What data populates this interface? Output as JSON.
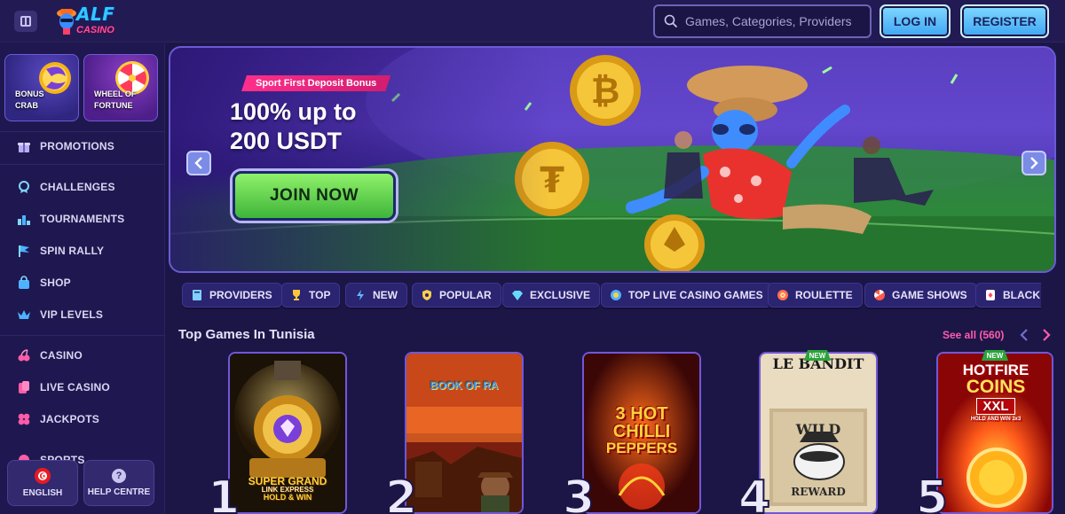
{
  "header": {
    "logo_main": "ALF",
    "logo_sub": "CASINO",
    "search_placeholder": "Games, Categories, Providers",
    "login_label": "LOG IN",
    "register_label": "REGISTER"
  },
  "sidebar": {
    "promo_tiles": [
      {
        "label_1": "BONUS",
        "label_2": "CRAB"
      },
      {
        "label_1": "WHEEL OF",
        "label_2": "FORTUNE"
      }
    ],
    "items": [
      {
        "label": "PROMOTIONS",
        "icon": "gift-icon"
      },
      {
        "label": "CHALLENGES",
        "icon": "medal-icon"
      },
      {
        "label": "TOURNAMENTS",
        "icon": "podium-icon"
      },
      {
        "label": "SPIN RALLY",
        "icon": "flag-icon"
      },
      {
        "label": "SHOP",
        "icon": "bag-icon"
      },
      {
        "label": "VIP LEVELS",
        "icon": "crown-icon"
      },
      {
        "label": "CASINO",
        "icon": "cherry-icon"
      },
      {
        "label": "LIVE CASINO",
        "icon": "cards-icon"
      },
      {
        "label": "JACKPOTS",
        "icon": "clover-icon"
      },
      {
        "label": "SPORTS",
        "icon": "ball-icon"
      }
    ],
    "language_label": "ENGLISH",
    "help_label": "HELP CENTRE",
    "help_glyph": "?"
  },
  "hero": {
    "tag": "Sport First Deposit Bonus",
    "title_line1": "100% up to",
    "title_line2": "200 USDT",
    "cta_label": "JOIN NOW",
    "prev_glyph": "‹",
    "next_glyph": "›"
  },
  "categories": [
    {
      "label": "PROVIDERS",
      "icon": "book-icon",
      "color": "#7fd0ff"
    },
    {
      "label": "TOP",
      "icon": "trophy-icon",
      "color": "#ffc53d"
    },
    {
      "label": "NEW",
      "icon": "bolt-icon",
      "color": "#5fb6ff"
    },
    {
      "label": "POPULAR",
      "icon": "shield-star-icon",
      "color": "#ffd04a"
    },
    {
      "label": "EXCLUSIVE",
      "icon": "diamond-icon",
      "color": "#66d9ff"
    },
    {
      "label": "TOP LIVE CASINO GAMES",
      "icon": "chip-icon",
      "color": "#4fb2ff"
    },
    {
      "label": "ROULETTE",
      "icon": "roulette-icon",
      "color": "#ff6d4d"
    },
    {
      "label": "GAME SHOWS",
      "icon": "wheel-icon",
      "color": "#ff5a4a"
    },
    {
      "label": "BLACK",
      "icon": "playing-card-icon",
      "color": "#ff4a6a"
    }
  ],
  "top_games": {
    "title": "Top Games In Tunisia",
    "see_all": "See all (560)",
    "games": [
      {
        "rank": "1",
        "title_1": "SUPER GRAND",
        "title_2": "LINK EXPRESS",
        "title_3": "HOLD & WIN",
        "badge": ""
      },
      {
        "rank": "2",
        "title_1": "BOOK OF RA",
        "title_2": "",
        "title_3": "",
        "badge": ""
      },
      {
        "rank": "3",
        "title_1": "3 HOT",
        "title_2": "CHILLI",
        "title_3": "PEPPERS",
        "badge": ""
      },
      {
        "rank": "4",
        "title_1": "LE BANDIT",
        "title_2": "WILD",
        "title_3": "REWARD",
        "badge": "NEW"
      },
      {
        "rank": "5",
        "title_1": "HOTFIRE",
        "title_2": "COINS",
        "title_3": "XXL",
        "badge": "NEW",
        "sub": "HOLD AND WIN 3x3"
      }
    ]
  },
  "colors": {
    "background": "#1c1646",
    "accent_pink": "#ff5cb0",
    "button_blue": "#4fb2ff",
    "cta_green": "#5fd143"
  }
}
